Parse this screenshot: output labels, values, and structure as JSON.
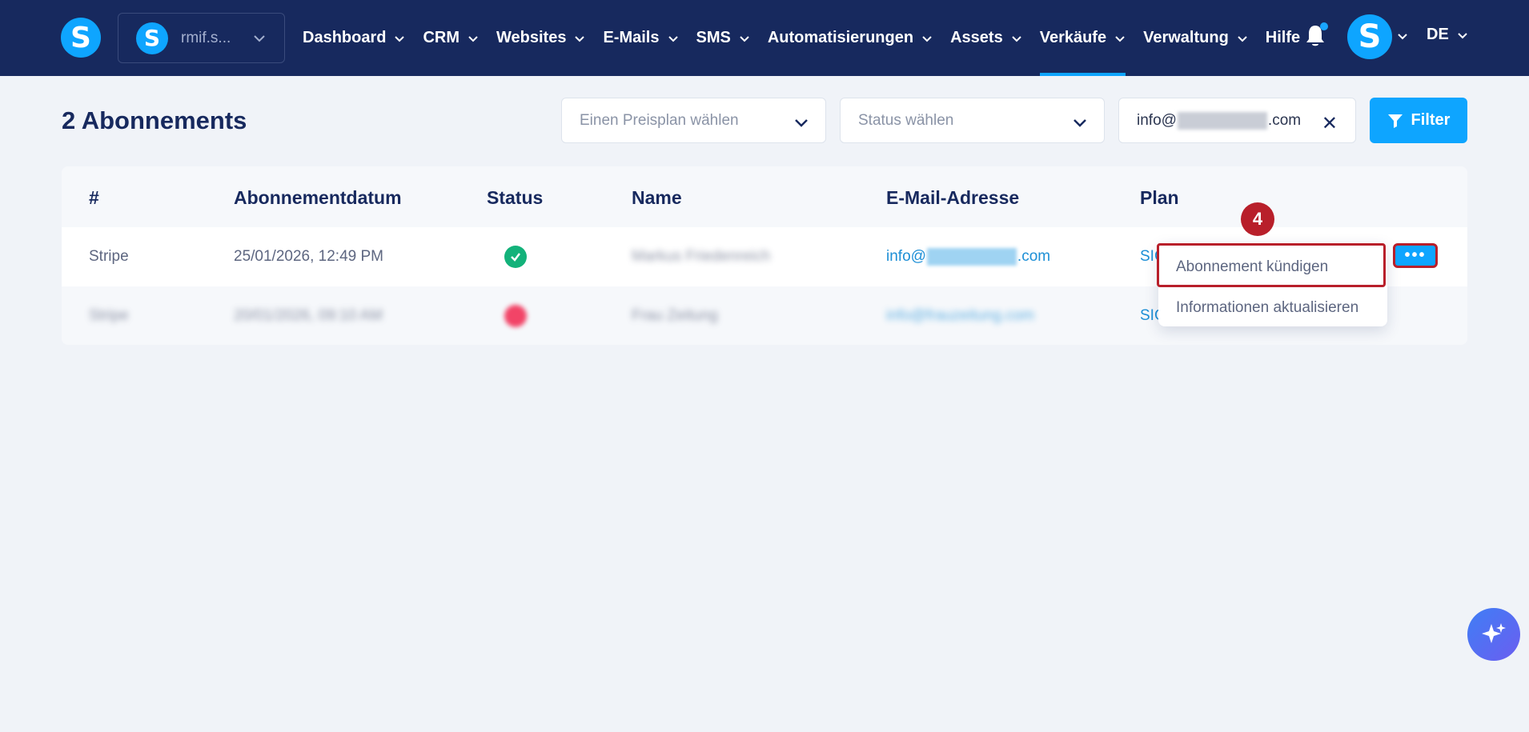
{
  "nav": {
    "logo_letter": "S",
    "account": {
      "avatar_letter": "S",
      "name": "rmif.s..."
    },
    "menu": [
      {
        "label": "Dashboard",
        "has_dropdown": true
      },
      {
        "label": "CRM",
        "has_dropdown": true
      },
      {
        "label": "Websites",
        "has_dropdown": true
      },
      {
        "label": "E-Mails",
        "has_dropdown": true
      },
      {
        "label": "SMS",
        "has_dropdown": true
      },
      {
        "label": "Automatisierungen",
        "has_dropdown": true
      },
      {
        "label": "Assets",
        "has_dropdown": true
      },
      {
        "label": "Verkäufe",
        "has_dropdown": true,
        "active": true
      },
      {
        "label": "Verwaltung",
        "has_dropdown": true
      },
      {
        "label": "Hilfe",
        "has_dropdown": false
      }
    ],
    "user_avatar_letter": "S",
    "language": "DE",
    "icons": [
      "bell-icon",
      "chevron-down-icon"
    ]
  },
  "header": {
    "title": "2 Abonnements",
    "plan_select_placeholder": "Einen Preisplan wählen",
    "status_select_placeholder": "Status wählen",
    "email_filter": {
      "prefix": "info@",
      "suffix": ".com"
    },
    "filter_button": "Filter"
  },
  "table": {
    "columns": [
      "#",
      "Abonnementdatum",
      "Status",
      "Name",
      "E-Mail-Adresse",
      "Plan"
    ],
    "rows": [
      {
        "source": "Stripe",
        "date": "25/01/2026, 12:49 PM",
        "status": "active",
        "name": "Markus Friedenreich",
        "email_prefix": "info@",
        "email_suffix": ".com",
        "plan": "SIG"
      },
      {
        "source": "Stripe",
        "date": "20/01/2026, 09:10 AM",
        "status": "inactive",
        "name": "Frau Zeitung",
        "email": "info@frauzeitung.com",
        "plan": "SIG"
      }
    ],
    "more_button": "•••"
  },
  "dropdown": {
    "items": [
      "Abonnement kündigen",
      "Informationen aktualisieren"
    ]
  },
  "annotation": {
    "step": "4"
  },
  "colors": {
    "nav_bg": "#17295e",
    "accent": "#0ea5ff",
    "highlight_red": "#b81f2a",
    "status_ok": "#13b27a",
    "status_bad": "#f24467"
  }
}
